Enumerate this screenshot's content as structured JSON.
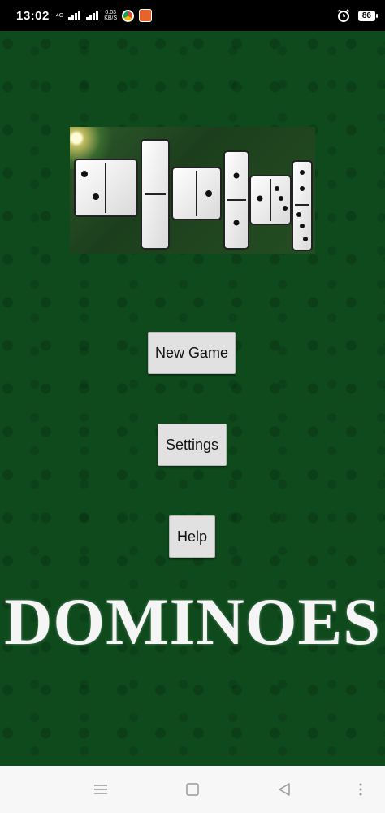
{
  "status_bar": {
    "time": "13:02",
    "network_type": "4G",
    "data_speed_value": "0.03",
    "data_speed_unit": "KB/S",
    "battery_level": "86"
  },
  "app": {
    "background_color": "#0e4a1c",
    "buttons": {
      "new_game": "New Game",
      "settings": "Settings",
      "help": "Help"
    },
    "title": "DOMINOES"
  },
  "icons": {
    "menu": "menu-icon",
    "home": "home-icon",
    "back": "back-icon",
    "more": "more-icon"
  }
}
